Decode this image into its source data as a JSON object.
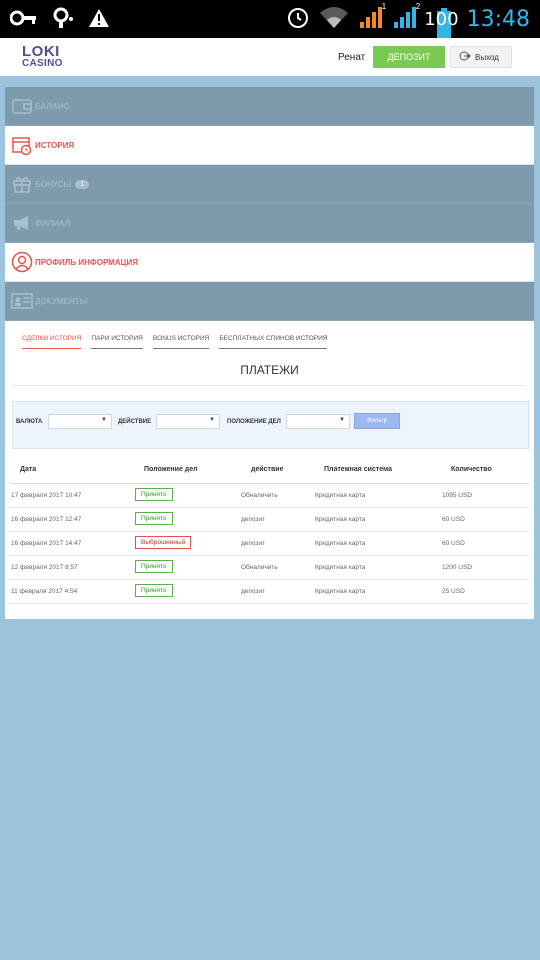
{
  "status_bar": {
    "time": "13:48",
    "battery": "100",
    "sim1": "1",
    "sim2": "2",
    "icons": [
      "key-icon",
      "key-sync-icon",
      "warning-icon",
      "alarm-icon",
      "wifi-icon",
      "signal-sim1-icon",
      "signal-sim2-icon",
      "battery-icon"
    ]
  },
  "header": {
    "logo_top": "LOKI",
    "logo_bottom": "CASINO",
    "username": "Ренат",
    "deposit_label": "ДЕПОЗИТ",
    "logout_label": "Выход"
  },
  "menu": {
    "items": [
      {
        "label": "БАЛАНС",
        "icon": "wallet-icon",
        "active": false
      },
      {
        "label": "ИСТОРИЯ",
        "icon": "calendar-clock-icon",
        "active": true
      },
      {
        "label": "БОНУСЫ",
        "icon": "gift-icon",
        "active": false,
        "badge": "1"
      },
      {
        "label": "ФИЛИАЛ",
        "icon": "megaphone-icon",
        "active": false
      },
      {
        "label": "ПРОФИЛЬ ИНФОРМАЦИЯ",
        "icon": "user-icon",
        "active": true
      },
      {
        "label": "ДОКУМЕНТЫ",
        "icon": "id-card-icon",
        "active": false
      }
    ]
  },
  "tabs": [
    {
      "label": "СДЕЛКИ ИСТОРИЯ",
      "active": true
    },
    {
      "label": "ПАРИ ИСТОРИЯ",
      "active": false
    },
    {
      "label": "BONUS ИСТОРИЯ",
      "active": false
    },
    {
      "label": "БЕСПЛАТНЫХ СПИНОВ ИСТОРИЯ",
      "active": false
    }
  ],
  "section_title": "ПЛАТЕЖИ",
  "filter": {
    "currency_label": "ВАЛЮТА",
    "action_label": "ДЕЙСТВИЕ",
    "status_label": "ПОЛОЖЕНИЕ ДЕЛ",
    "button_label": "Фильтр"
  },
  "table": {
    "columns": [
      "Дата",
      "Положение дел",
      "действие",
      "Платежная система",
      "Количество"
    ],
    "rows": [
      {
        "date": "17 февраля 2017 10:47",
        "status": "Принято",
        "status_type": "ok",
        "action": "Обналичить",
        "system": "Кредитная карта",
        "amount": "1095 USD"
      },
      {
        "date": "16 февраля 2017 12:47",
        "status": "Принято",
        "status_type": "ok",
        "action": "депозит",
        "system": "Кредитная карта",
        "amount": "60 USD"
      },
      {
        "date": "16 февраля 2017 14:47",
        "status": "Выброшенный",
        "status_type": "bad",
        "action": "депозит",
        "system": "Кредитная карта",
        "amount": "60 USD"
      },
      {
        "date": "12 февраля 2017 8:57",
        "status": "Принято",
        "status_type": "ok",
        "action": "Обналичить",
        "system": "Кредитная карта",
        "amount": "1200 USD"
      },
      {
        "date": "11 февраля 2017 4:54",
        "status": "Принято",
        "status_type": "ok",
        "action": "депозит",
        "system": "Кредитная карта",
        "amount": "25 USD"
      }
    ]
  },
  "colors": {
    "accent": "#e8544e",
    "deposit": "#79c952",
    "menu_dark": "#7e9aad",
    "page_bg": "#9bc3dc",
    "status_ok": "#5ab04a",
    "status_bad": "#d9534f"
  }
}
